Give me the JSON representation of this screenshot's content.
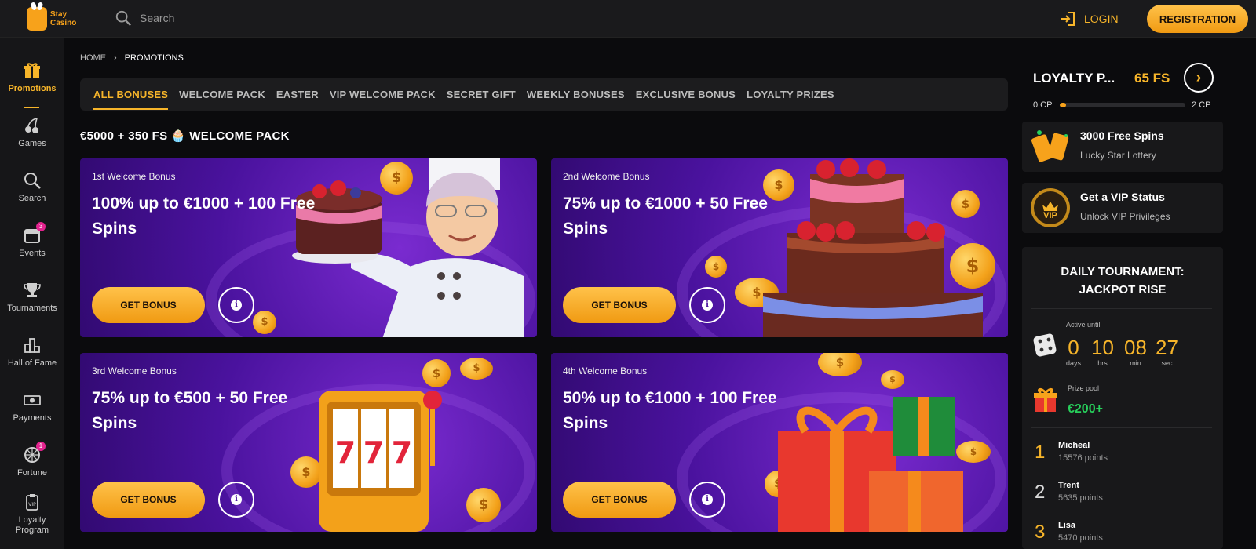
{
  "header": {
    "logo_line1": "Stay",
    "logo_line2": "Casino",
    "search_placeholder": "Search",
    "login_label": "LOGIN",
    "registration_label": "REGISTRATION"
  },
  "sidebar": {
    "items": [
      {
        "label": "Promotions",
        "icon": "gift-icon"
      },
      {
        "label": "Games",
        "icon": "cherries-icon"
      },
      {
        "label": "Search",
        "icon": "search-icon"
      },
      {
        "label": "Events",
        "icon": "calendar-icon",
        "badge": "3"
      },
      {
        "label": "Tournaments",
        "icon": "trophy-icon"
      },
      {
        "label": "Hall of Fame",
        "icon": "podium-icon"
      },
      {
        "label": "Payments",
        "icon": "cash-icon"
      },
      {
        "label": "Fortune",
        "icon": "wheel-icon",
        "badge": "1"
      },
      {
        "label": "Loyalty Program",
        "icon": "vip-badge-icon"
      }
    ]
  },
  "breadcrumb": {
    "home": "HOME",
    "current": "PROMOTIONS"
  },
  "tabs": [
    "ALL BONUSES",
    "WELCOME PACK",
    "EASTER",
    "VIP WELCOME PACK",
    "SECRET GIFT",
    "WEEKLY BONUSES",
    "EXCLUSIVE BONUS",
    "LOYALTY PRIZES"
  ],
  "section_title": "€5000 + 350 FS 🧁 WELCOME PACK",
  "bonuses": [
    {
      "label": "1st Welcome Bonus",
      "headline": "100% up to €1000 + 100 Free Spins",
      "button": "GET BONUS"
    },
    {
      "label": "2nd Welcome Bonus",
      "headline": "75% up to €1000 + 50 Free Spins",
      "button": "GET BONUS"
    },
    {
      "label": "3rd Welcome Bonus",
      "headline": "75% up to €500 + 50 Free Spins",
      "button": "GET BONUS"
    },
    {
      "label": "4th Welcome Bonus",
      "headline": "50% up to €1000 + 100 Free Spins",
      "button": "GET BONUS"
    }
  ],
  "loyalty": {
    "title": "LOYALTY P...",
    "free_spins": "65 FS",
    "cp_min": "0 CP",
    "cp_max": "2 CP",
    "progress": 0.05
  },
  "promos": [
    {
      "title": "3000 Free Spins",
      "subtitle": "Lucky Star Lottery"
    },
    {
      "title": "Get a VIP Status",
      "subtitle": "Unlock VIP Privileges",
      "badge": "VIP"
    }
  ],
  "tournament": {
    "title_line1": "DAILY TOURNAMENT:",
    "title_line2": "JACKPOT RISE",
    "active_until": "Active until",
    "countdown": [
      {
        "value": "0",
        "unit": "days"
      },
      {
        "value": "10",
        "unit": "hrs"
      },
      {
        "value": "08",
        "unit": "min"
      },
      {
        "value": "27",
        "unit": "sec"
      }
    ],
    "prize_label": "Prize pool",
    "prize_value": "€200+",
    "leaders": [
      {
        "rank": "1",
        "name": "Micheal",
        "points": "15576 points"
      },
      {
        "rank": "2",
        "name": "Trent",
        "points": "5635 points"
      },
      {
        "rank": "3",
        "name": "Lisa",
        "points": "5470 points"
      }
    ]
  },
  "colors": {
    "accent": "#f7b52a",
    "background": "#0b0b0d",
    "card_purple": "#4a129e",
    "prize_green": "#27d05b",
    "badge_pink": "#e4238f"
  }
}
